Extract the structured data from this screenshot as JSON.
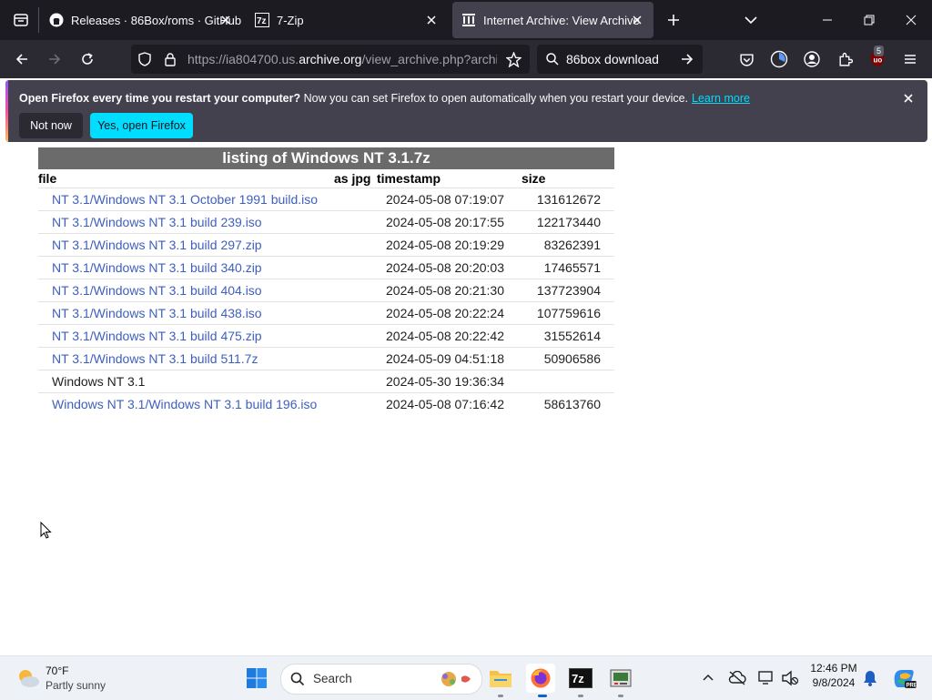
{
  "tabs": [
    {
      "label": "Releases · 86Box/roms · GitHub",
      "icon": "github-icon"
    },
    {
      "label": "7-Zip",
      "icon": "7zip-icon"
    },
    {
      "label": "Internet Archive: View Archive",
      "icon": "archive-icon"
    }
  ],
  "nav": {
    "url_prefix": "https://ia804700.us.",
    "url_domain": "archive.org",
    "url_suffix": "/view_archive.php?archive=",
    "search_text": "86box download",
    "ublock_badge": "5"
  },
  "notification": {
    "bold": "Open Firefox every time you restart your computer?",
    "text": " Now you can set Firefox to open automatically when you restart your device.",
    "link": "Learn more",
    "not_now": "Not now",
    "yes": "Yes, open Firefox"
  },
  "listing": {
    "title": "listing of Windows NT 3.1.7z",
    "col_file": "file",
    "col_jpg": "as jpg",
    "col_timestamp": "timestamp",
    "col_size": "size",
    "rows": [
      {
        "file": "NT 3.1/Windows NT 3.1 October 1991 build.iso",
        "timestamp": "2024-05-08 07:19:07",
        "size": "131612672"
      },
      {
        "file": "NT 3.1/Windows NT 3.1 build 239.iso",
        "timestamp": "2024-05-08 20:17:55",
        "size": "122173440"
      },
      {
        "file": "NT 3.1/Windows NT 3.1 build 297.zip",
        "timestamp": "2024-05-08 20:19:29",
        "size": "83262391"
      },
      {
        "file": "NT 3.1/Windows NT 3.1 build 340.zip",
        "timestamp": "2024-05-08 20:20:03",
        "size": "17465571"
      },
      {
        "file": "NT 3.1/Windows NT 3.1 build 404.iso",
        "timestamp": "2024-05-08 20:21:30",
        "size": "137723904"
      },
      {
        "file": "NT 3.1/Windows NT 3.1 build 438.iso",
        "timestamp": "2024-05-08 20:22:24",
        "size": "107759616"
      },
      {
        "file": "NT 3.1/Windows NT 3.1 build 475.zip",
        "timestamp": "2024-05-08 20:22:42",
        "size": "31552614"
      },
      {
        "file": "NT 3.1/Windows NT 3.1 build 511.7z",
        "timestamp": "2024-05-09 04:51:18",
        "size": "50906586"
      },
      {
        "file": "Windows NT 3.1",
        "timestamp": "2024-05-30 19:36:34",
        "size": ""
      },
      {
        "file": "Windows NT 3.1/Windows NT 3.1 build 196.iso",
        "timestamp": "2024-05-08 07:16:42",
        "size": "58613760"
      }
    ]
  },
  "taskbar": {
    "weather_temp": "70°F",
    "weather_desc": "Partly sunny",
    "search_label": "Search",
    "time": "12:46 PM",
    "date": "9/8/2024"
  }
}
